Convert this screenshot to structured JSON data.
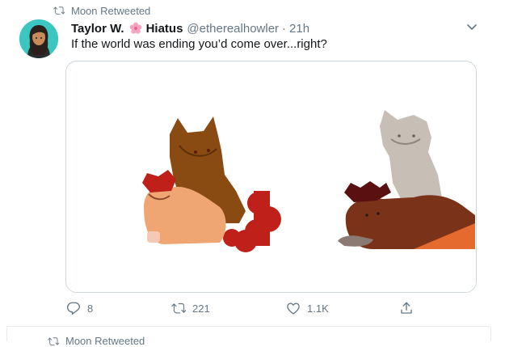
{
  "tweet": {
    "retweeted_by": "Moon Retweeted",
    "author_name": "Taylor W.",
    "author_status": "Hiatus",
    "author_handle": "@etherealhowler",
    "separator": "·",
    "timestamp": "21h",
    "text": "If the world was ending you’d come over...right?",
    "actions": {
      "replies": "8",
      "retweets": "221",
      "likes": "1.1K"
    },
    "icons": [
      "retweet-icon",
      "flower-emoji-icon",
      "chevron-down-icon",
      "reply-icon",
      "retweet-icon",
      "heart-icon",
      "share-icon"
    ]
  },
  "next_tweet": {
    "retweeted_by": "Moon Retweeted"
  },
  "colors": {
    "text_primary": "#14171a",
    "text_secondary": "#657786",
    "border": "#ccd6dd",
    "avatar_bg": "#3cc6c2"
  }
}
